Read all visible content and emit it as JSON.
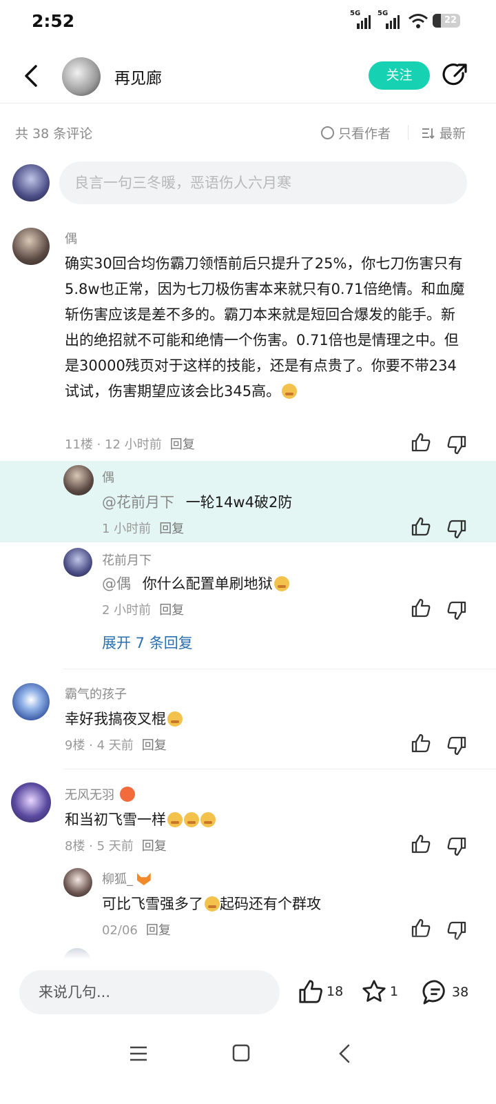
{
  "status": {
    "time": "2:52",
    "battery": "22",
    "net1": "5G",
    "net2": "5G"
  },
  "header": {
    "author": "再见廊",
    "follow_label": "关注"
  },
  "filters": {
    "count": "共 38 条评论",
    "author_only": "只看作者",
    "sort": "最新"
  },
  "compose": {
    "placeholder": "良言一句三冬暖，恶语伤人六月寒"
  },
  "comments": [
    {
      "name": "偶",
      "text": "确实30回合均伤霸刀领悟前后只提升了25%，你七刀伤害只有5.8w也正常，因为七刀极伤害本来就只有0.71倍绝情。和血魔斩伤害应该是差不多的。霸刀本来就是短回合爆发的能手。新出的绝招就不可能和绝情一个伤害。0.71倍也是情理之中。但是30000残页对于这样的技能，还是有点贵了。你要不带234试试，伤害期望应该会比345高。",
      "meta": "11楼 · 12 小时前",
      "reply": "回复",
      "replies": [
        {
          "name": "偶",
          "mention": "@花前月下",
          "text": "一轮14w4破2防",
          "meta": "1 小时前",
          "reply": "回复"
        },
        {
          "name": "花前月下",
          "mention": "@偶",
          "text": "你什么配置单刷地狱",
          "meta": "2 小时前",
          "reply": "回复"
        }
      ],
      "expand": "展开 7 条回复"
    },
    {
      "name": "霸气的孩子",
      "text": "幸好我搞夜叉棍",
      "meta": "9楼 · 4 天前",
      "reply": "回复"
    },
    {
      "name": "无风无羽",
      "text": "和当初飞雪一样",
      "meta": "8楼 · 5 天前",
      "reply": "回复",
      "replies": [
        {
          "name": "柳狐_",
          "text": "可比飞雪强多了",
          "text2": "起码还有个群攻",
          "meta": "02/06",
          "reply": "回复"
        }
      ]
    }
  ],
  "bottom": {
    "say_placeholder": "来说几句...",
    "likes": "18",
    "stars": "1",
    "comments": "38"
  },
  "colors": {
    "accent": "#17d1b3",
    "highlight": "#e3f6f3",
    "link": "#2a6fb1"
  }
}
